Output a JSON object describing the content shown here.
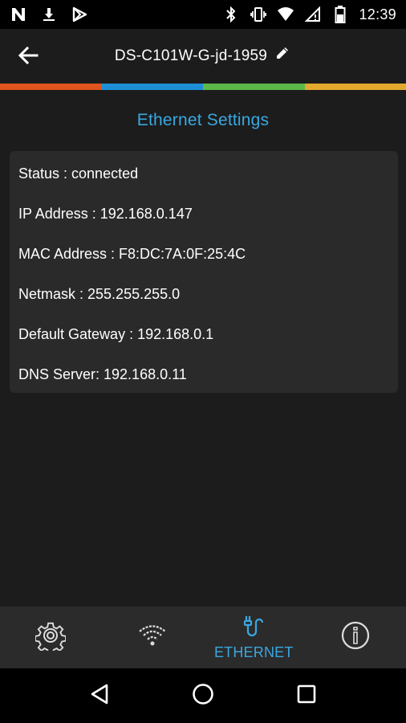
{
  "status_bar": {
    "time": "12:39",
    "left_icons": [
      "n-notification-icon",
      "download-icon",
      "play-store-icon"
    ],
    "right_icons": [
      "bluetooth-icon",
      "vibrate-icon",
      "wifi-icon",
      "no-sim-icon",
      "battery-icon"
    ]
  },
  "header": {
    "title": "DS-C101W-G-jd-1959",
    "back_icon": "arrow-back-icon",
    "edit_icon": "pencil-icon"
  },
  "color_strip": [
    "#e0541e",
    "#1e8fd6",
    "#5cb848",
    "#e3a92f"
  ],
  "section": {
    "title": "Ethernet Settings"
  },
  "info": {
    "status": "Status : connected",
    "ip": "IP Address : 192.168.0.147",
    "mac": "MAC Address : F8:DC:7A:0F:25:4C",
    "netmask": "Netmask : 255.255.255.0",
    "gateway": "Default Gateway : 192.168.0.1",
    "dns": "DNS Server: 192.168.0.11"
  },
  "bottom_nav": {
    "items": [
      {
        "name": "settings",
        "icon": "gear-icon",
        "label": ""
      },
      {
        "name": "wifi",
        "icon": "wifi-icon",
        "label": ""
      },
      {
        "name": "ethernet",
        "icon": "plug-icon",
        "label": "ETHERNET",
        "active": true
      },
      {
        "name": "info",
        "icon": "info-icon",
        "label": ""
      }
    ],
    "active_color": "#3aa8e0"
  },
  "system_nav": {
    "icons": [
      "back-triangle-icon",
      "home-circle-icon",
      "recents-square-icon"
    ]
  }
}
